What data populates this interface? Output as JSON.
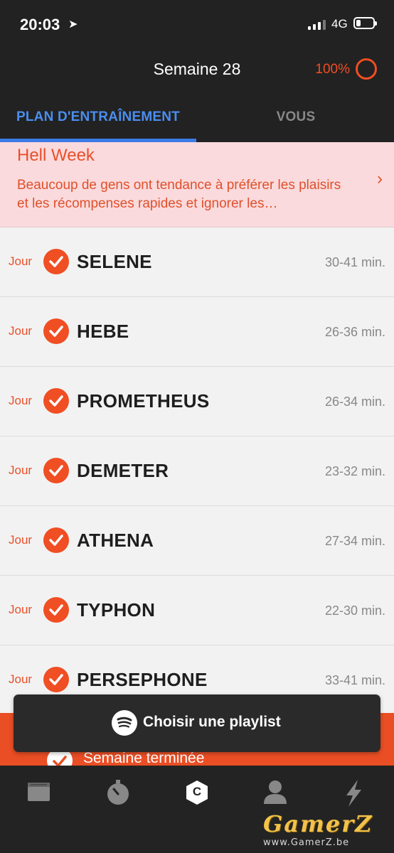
{
  "status_bar": {
    "time": "20:03",
    "network": "4G"
  },
  "header": {
    "title": "Semaine 28",
    "progress_text": "100%",
    "progress_value": 1.0
  },
  "tabs": [
    {
      "label": "PLAN D'ENTRAÎNEMENT",
      "active": true
    },
    {
      "label": "VOUS",
      "active": false
    }
  ],
  "banner": {
    "title": "Hell Week",
    "text": "Beaucoup de gens ont tendance à préférer les plaisirs et les récompenses rapides et ignorer les…"
  },
  "workouts": [
    {
      "day": "Jour",
      "name": "SELENE",
      "duration": "30-41 min.",
      "done": true
    },
    {
      "day": "Jour",
      "name": "HEBE",
      "duration": "26-36 min.",
      "done": true
    },
    {
      "day": "Jour",
      "name": "PROMETHEUS",
      "duration": "26-34 min.",
      "done": true
    },
    {
      "day": "Jour",
      "name": "DEMETER",
      "duration": "23-32 min.",
      "done": true
    },
    {
      "day": "Jour",
      "name": "ATHENA",
      "duration": "27-34 min.",
      "done": true
    },
    {
      "day": "Jour",
      "name": "TYPHON",
      "duration": "22-30 min.",
      "done": true
    },
    {
      "day": "Jour",
      "name": "PERSEPHONE",
      "duration": "33-41 min.",
      "done": true
    }
  ],
  "week_done": {
    "label": "Semaine terminée"
  },
  "playlist_button": {
    "label": "Choisir une playlist"
  },
  "navbar": {
    "items": [
      "calendar-icon",
      "stopwatch-icon",
      "coach-icon",
      "profile-icon",
      "lightning-icon"
    ],
    "coach_badge": "C"
  },
  "watermark": {
    "text": "GamerZ",
    "url": "www.GamerZ.be"
  },
  "colors": {
    "accent": "#f04e23",
    "tab_active": "#4a8ef0",
    "banner_bg": "#fadadd"
  }
}
